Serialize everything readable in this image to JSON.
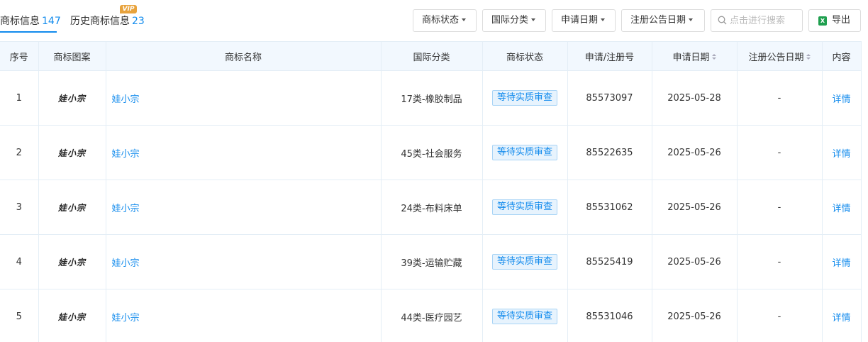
{
  "tabs": [
    {
      "label": "商标信息",
      "count": "147",
      "active": true
    },
    {
      "label": "历史商标信息",
      "count": "23",
      "badge": "VIP"
    }
  ],
  "filters": [
    {
      "label": "商标状态"
    },
    {
      "label": "国际分类"
    },
    {
      "label": "申请日期"
    },
    {
      "label": "注册公告日期"
    }
  ],
  "search": {
    "placeholder": "点击进行搜索",
    "value": ""
  },
  "export": {
    "label": "导出",
    "icon": "excel-icon"
  },
  "colors": {
    "accent": "#128bed",
    "header_bg": "#f2f8fe",
    "vip": "#e8a33d"
  },
  "table": {
    "columns": [
      "序号",
      "商标图案",
      "商标名称",
      "国际分类",
      "商标状态",
      "申请/注册号",
      "申请日期",
      "注册公告日期",
      "内容"
    ],
    "rows": [
      {
        "index": "1",
        "logo": "娃小宗",
        "name": "娃小宗",
        "class": "17类-橡胶制品",
        "status": "等待实质审查",
        "reg_no": "85573097",
        "apply_date": "2025-05-28",
        "pub_date": "-",
        "action": "详情"
      },
      {
        "index": "2",
        "logo": "娃小宗",
        "name": "娃小宗",
        "class": "45类-社会服务",
        "status": "等待实质审查",
        "reg_no": "85522635",
        "apply_date": "2025-05-26",
        "pub_date": "-",
        "action": "详情"
      },
      {
        "index": "3",
        "logo": "娃小宗",
        "name": "娃小宗",
        "class": "24类-布料床单",
        "status": "等待实质审查",
        "reg_no": "85531062",
        "apply_date": "2025-05-26",
        "pub_date": "-",
        "action": "详情"
      },
      {
        "index": "4",
        "logo": "娃小宗",
        "name": "娃小宗",
        "class": "39类-运输贮藏",
        "status": "等待实质审查",
        "reg_no": "85525419",
        "apply_date": "2025-05-26",
        "pub_date": "-",
        "action": "详情"
      },
      {
        "index": "5",
        "logo": "娃小宗",
        "name": "娃小宗",
        "class": "44类-医疗园艺",
        "status": "等待实质审查",
        "reg_no": "85531046",
        "apply_date": "2025-05-26",
        "pub_date": "-",
        "action": "详情"
      }
    ]
  }
}
